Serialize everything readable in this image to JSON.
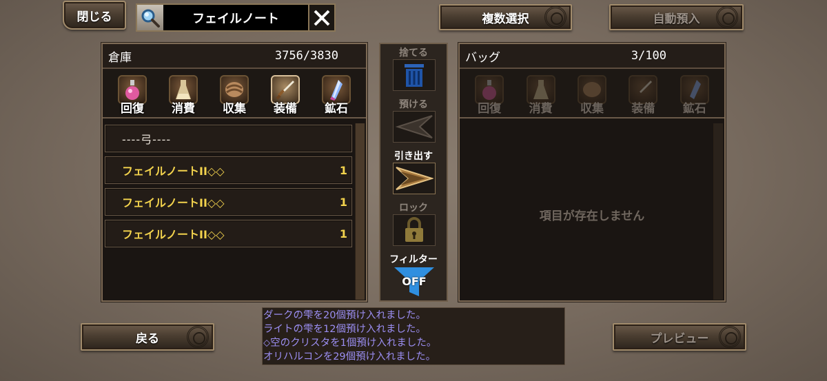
{
  "top_bar": {
    "close_label": "閉じる",
    "search_value": "フェイルノート",
    "multi_select_label": "複数選択",
    "auto_deposit_label": "自動預入"
  },
  "storage": {
    "title": "倉庫",
    "count": "3756/3830",
    "tabs": [
      {
        "label": "回復",
        "icon": "potion-icon"
      },
      {
        "label": "消費",
        "icon": "vial-icon"
      },
      {
        "label": "収集",
        "icon": "material-icon"
      },
      {
        "label": "装備",
        "icon": "sword-icon"
      },
      {
        "label": "鉱石",
        "icon": "crystal-icon"
      }
    ],
    "active_tab": "装備",
    "category_header": "----弓----",
    "items": [
      {
        "name": "フェイルノートII◇◇",
        "qty": "1"
      },
      {
        "name": "フェイルノートII◇◇",
        "qty": "1"
      },
      {
        "name": "フェイルノートII◇◇",
        "qty": "1"
      }
    ]
  },
  "actions": {
    "discard_label": "捨てる",
    "deposit_label": "預ける",
    "withdraw_label": "引き出す",
    "lock_label": "ロック",
    "filter_label": "フィルター",
    "filter_state": "OFF"
  },
  "bag": {
    "title": "バッグ",
    "count": "3/100",
    "tabs": [
      {
        "label": "回復"
      },
      {
        "label": "消費"
      },
      {
        "label": "収集"
      },
      {
        "label": "装備"
      },
      {
        "label": "鉱石"
      }
    ],
    "empty_message": "項目が存在しません"
  },
  "bottom": {
    "back_label": "戻る",
    "preview_label": "プレビュー"
  },
  "log": [
    "ダークの雫を20個預け入れました。",
    "ライトの雫を12個預け入れました。",
    "⬦空のクリスタを1個預け入れました。",
    "オリハルコンを29個預け入れました。"
  ],
  "colors": {
    "item_name": "#f3d34d",
    "log_text": "#9b8ef2",
    "filter_blue": "#2f8fe0"
  }
}
